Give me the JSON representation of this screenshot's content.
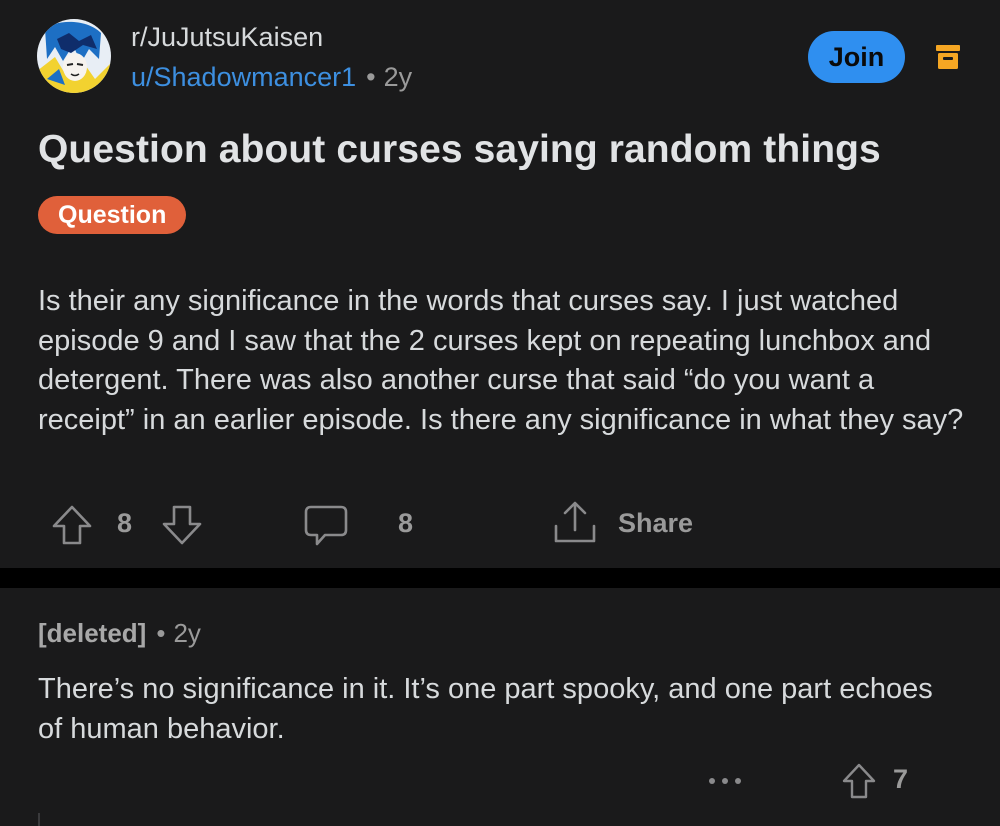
{
  "post": {
    "subreddit": "r/JuJutsuKaisen",
    "author": "u/Shadowmancer1",
    "age": "2y",
    "join_label": "Join",
    "title": "Question about curses saying random things",
    "flair": "Question",
    "body": "Is their any significance in the words that curses say. I just watched episode 9 and I saw that the 2 curses kept on repeating lunchbox and detergent. There was also another curse that said “do you want a receipt” in an earlier episode. Is there any significance in what they say?",
    "score": "8",
    "comment_count": "8",
    "share_label": "Share"
  },
  "comment": {
    "author": "[deleted]",
    "age": "2y",
    "body": "There’s no significance in it. It’s one part spooky, and one part echoes of human behavior.",
    "score": "7"
  },
  "colors": {
    "background": "#000000",
    "card": "#1a1a1b",
    "accent": "#2f8ff0",
    "author_link": "#3d8fe0",
    "flair": "#e0603a",
    "archive_icon": "#f5a623"
  },
  "icons": [
    "subreddit-avatar-icon",
    "archive-icon",
    "upvote-icon",
    "downvote-icon",
    "comment-icon",
    "share-icon",
    "more-options-icon"
  ]
}
